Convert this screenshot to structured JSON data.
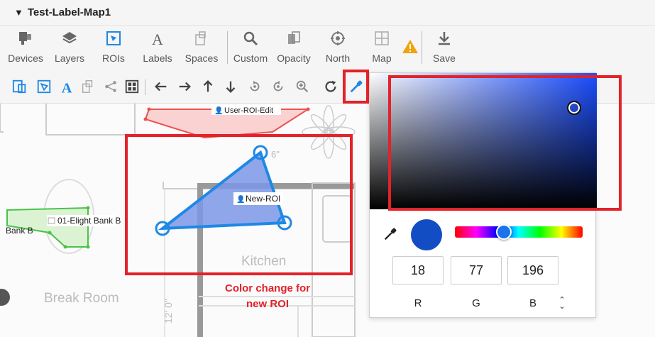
{
  "title": "Test-Label-Map1",
  "toolbar": {
    "devices": "Devices",
    "layers": "Layers",
    "rois": "ROIs",
    "labels": "Labels",
    "spaces": "Spaces",
    "custom": "Custom",
    "opacity": "Opacity",
    "north": "North",
    "map": "Map",
    "save": "Save"
  },
  "map": {
    "roi_user": "User-ROI-Edit",
    "roi_new": "New-ROI",
    "roi_elight": "01-Elight Bank B",
    "roi_bank": "Bank B",
    "kitchen": "Kitchen",
    "break_room": "Break Room",
    "dim_6": "6\"",
    "dim_12": "12' 0\""
  },
  "picker": {
    "r": "18",
    "g": "77",
    "b": "196",
    "r_label": "R",
    "g_label": "G",
    "b_label": "B",
    "toggle": "⌃⌄",
    "color": "#124dc4"
  },
  "annotation": {
    "line1": "Color change for",
    "line2": "new ROI"
  },
  "colors": {
    "accent": "#1e88e5",
    "warning": "#f0a30a",
    "annotation": "#e32229",
    "roi_fill": "#7b96e8"
  }
}
